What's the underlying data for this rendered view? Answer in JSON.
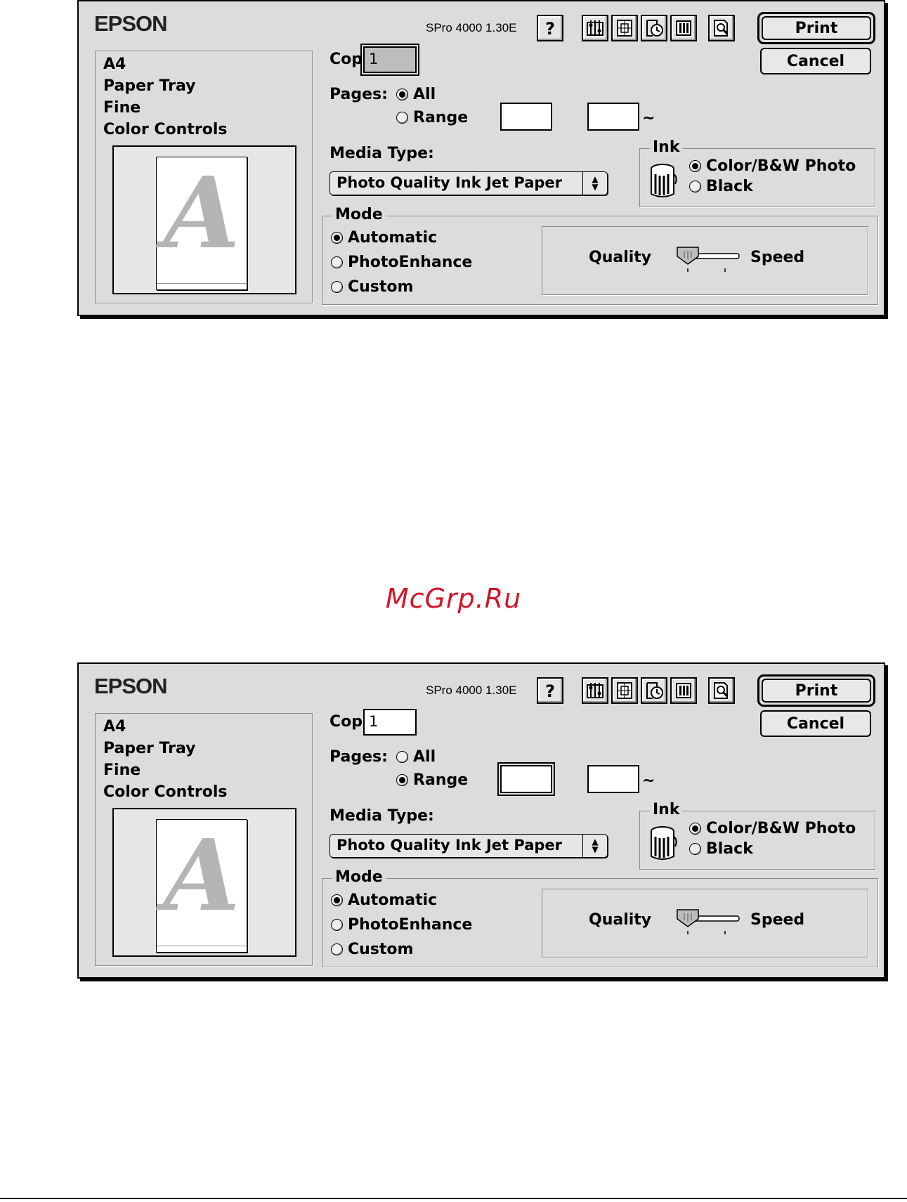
{
  "dialogs": [
    {
      "logo": "EPSON",
      "version": "SPro 4000 1.30E",
      "print_label": "Print",
      "cancel_label": "Cancel",
      "summary": [
        "A4",
        "Paper Tray",
        "Fine",
        "Color Controls"
      ],
      "preview_letter": "A",
      "copies_label": "Copies:",
      "copies_value": "1",
      "pages_label": "Pages:",
      "pages_all": "All",
      "pages_range": "Range",
      "pages_selected": "All",
      "tilde": "~",
      "media_label": "Media Type:",
      "media_value": "Photo Quality Ink Jet Paper",
      "ink_title": "Ink",
      "ink_color": "Color/B&W Photo",
      "ink_black": "Black",
      "ink_selected": "Color/B&W Photo",
      "mode_title": "Mode",
      "mode_automatic": "Automatic",
      "mode_photoenhance": "PhotoEnhance",
      "mode_custom": "Custom",
      "mode_selected": "Automatic",
      "quality_label": "Quality",
      "speed_label": "Speed",
      "copies_focused": true
    },
    {
      "logo": "EPSON",
      "version": "SPro 4000 1.30E",
      "print_label": "Print",
      "cancel_label": "Cancel",
      "summary": [
        "A4",
        "Paper Tray",
        "Fine",
        "Color Controls"
      ],
      "preview_letter": "A",
      "copies_label": "Copies:",
      "copies_value": "1",
      "pages_label": "Pages:",
      "pages_all": "All",
      "pages_range": "Range",
      "pages_selected": "Range",
      "tilde": "~",
      "media_label": "Media Type:",
      "media_value": "Photo Quality Ink Jet Paper",
      "ink_title": "Ink",
      "ink_color": "Color/B&W Photo",
      "ink_black": "Black",
      "ink_selected": "Color/B&W Photo",
      "mode_title": "Mode",
      "mode_automatic": "Automatic",
      "mode_photoenhance": "PhotoEnhance",
      "mode_custom": "Custom",
      "mode_selected": "Automatic",
      "quality_label": "Quality",
      "speed_label": "Speed",
      "copies_focused": false
    }
  ],
  "toolbar_icons": [
    "help-icon",
    "utility-icon",
    "layout-icon",
    "background-print-icon",
    "status-monitor-icon",
    "preview-icon"
  ],
  "watermark": "McGrp.Ru",
  "colors": {
    "dialog_bg": "#dcdcdc",
    "watermark": "#d3162a"
  }
}
